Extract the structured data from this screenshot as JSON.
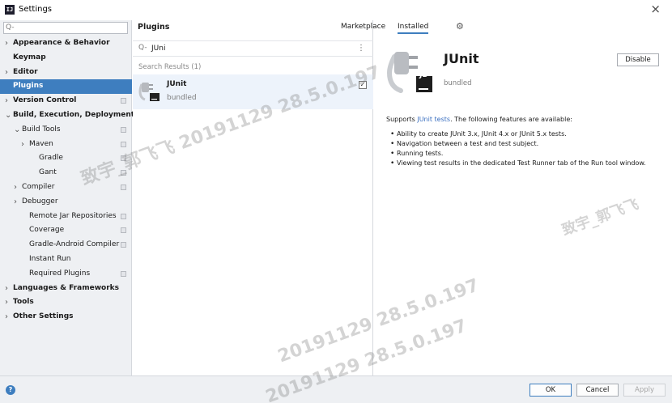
{
  "window": {
    "title": "Settings",
    "app_icon_text": "IJ",
    "close_glyph": "×"
  },
  "left": {
    "search": {
      "value": "",
      "placeholder": "Q-"
    },
    "items": [
      {
        "label": "Appearance & Behavior",
        "level": 0,
        "arrow": ">",
        "bold": true,
        "cfg": false,
        "selected": false
      },
      {
        "label": "Keymap",
        "level": 0,
        "arrow": "",
        "bold": true,
        "cfg": false,
        "selected": false
      },
      {
        "label": "Editor",
        "level": 0,
        "arrow": ">",
        "bold": true,
        "cfg": false,
        "selected": false
      },
      {
        "label": "Plugins",
        "level": 0,
        "arrow": "",
        "bold": true,
        "cfg": false,
        "selected": true
      },
      {
        "label": "Version Control",
        "level": 0,
        "arrow": ">",
        "bold": true,
        "cfg": true,
        "selected": false
      },
      {
        "label": "Build, Execution, Deployment",
        "level": 0,
        "arrow": "v",
        "bold": true,
        "cfg": false,
        "selected": false
      },
      {
        "label": "Build Tools",
        "level": 1,
        "arrow": "v",
        "bold": false,
        "cfg": true,
        "selected": false
      },
      {
        "label": "Maven",
        "level": 2,
        "arrow": ">",
        "bold": false,
        "cfg": true,
        "selected": false
      },
      {
        "label": "Gradle",
        "level": 3,
        "arrow": "",
        "bold": false,
        "cfg": true,
        "selected": false
      },
      {
        "label": "Gant",
        "level": 3,
        "arrow": "",
        "bold": false,
        "cfg": true,
        "selected": false
      },
      {
        "label": "Compiler",
        "level": 1,
        "arrow": ">",
        "bold": false,
        "cfg": true,
        "selected": false
      },
      {
        "label": "Debugger",
        "level": 1,
        "arrow": ">",
        "bold": false,
        "cfg": false,
        "selected": false
      },
      {
        "label": "Remote Jar Repositories",
        "level": 2,
        "arrow": "",
        "bold": false,
        "cfg": true,
        "selected": false
      },
      {
        "label": "Coverage",
        "level": 2,
        "arrow": "",
        "bold": false,
        "cfg": true,
        "selected": false
      },
      {
        "label": "Gradle-Android Compiler",
        "level": 2,
        "arrow": "",
        "bold": false,
        "cfg": true,
        "selected": false
      },
      {
        "label": "Instant Run",
        "level": 2,
        "arrow": "",
        "bold": false,
        "cfg": false,
        "selected": false
      },
      {
        "label": "Required Plugins",
        "level": 2,
        "arrow": "",
        "bold": false,
        "cfg": true,
        "selected": false
      },
      {
        "label": "Languages & Frameworks",
        "level": 0,
        "arrow": ">",
        "bold": true,
        "cfg": false,
        "selected": false
      },
      {
        "label": "Tools",
        "level": 0,
        "arrow": ">",
        "bold": true,
        "cfg": false,
        "selected": false
      },
      {
        "label": "Other Settings",
        "level": 0,
        "arrow": ">",
        "bold": true,
        "cfg": false,
        "selected": false
      }
    ]
  },
  "middle": {
    "header": "Plugins",
    "search": {
      "icon_glyph": "Q-",
      "value": "JUni",
      "kebab_glyph": "⋮"
    },
    "results_label": "Search Results (1)",
    "result": {
      "name": "JUnit",
      "sub": "bundled",
      "checked_glyph": "✓"
    }
  },
  "right": {
    "tabs": {
      "marketplace": "Marketplace",
      "installed": "Installed"
    },
    "gear_glyph": "⚙",
    "plugin": {
      "name": "JUnit",
      "sub": "bundled",
      "badge": "JB"
    },
    "disable_label": "Disable",
    "desc_prefix": "Supports ",
    "desc_link": "JUnit tests",
    "desc_suffix": ". The following features are available:",
    "features": [
      "Ability to create JUnit 3.x, JUnit 4.x or JUnit 5.x tests.",
      "Navigation between a test and test subject.",
      "Running tests.",
      "Viewing test results in the dedicated Test Runner tab of the Run tool window."
    ]
  },
  "bottom": {
    "help_glyph": "?",
    "ok": "OK",
    "cancel": "Cancel",
    "apply": "Apply"
  },
  "watermarks": [
    "致宇_郭飞飞 20191129 28.5.0.197",
    "致宇_郭飞飞",
    "20191129 28.5.0.197",
    "20191129 28.5.0.197"
  ],
  "colors": {
    "selection": "#3e7ebf",
    "link": "#3a6fc0",
    "panel_bg": "#eef0f3"
  }
}
